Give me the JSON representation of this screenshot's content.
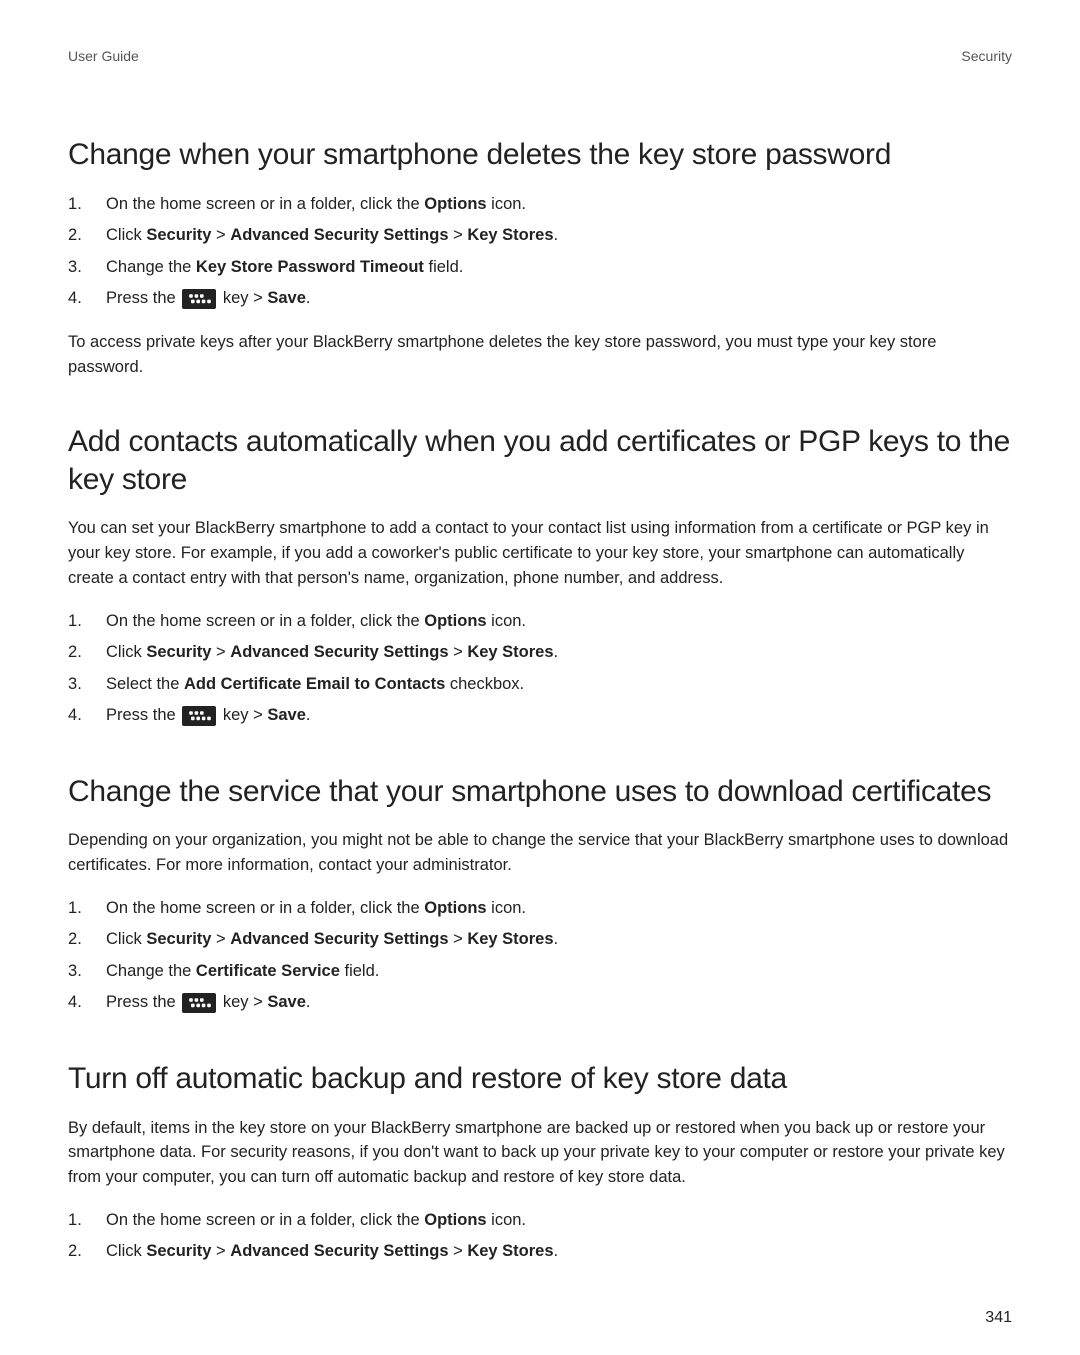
{
  "header": {
    "left": "User Guide",
    "right": "Security"
  },
  "sections": [
    {
      "title": "Change when your smartphone deletes the key store password",
      "intro": "",
      "steps": [
        [
          {
            "t": "On the home screen or in a folder, click the "
          },
          {
            "t": "Options",
            "b": true
          },
          {
            "t": " icon."
          }
        ],
        [
          {
            "t": "Click "
          },
          {
            "t": "Security",
            "b": true
          },
          {
            "t": " > "
          },
          {
            "t": "Advanced Security Settings",
            "b": true
          },
          {
            "t": " > "
          },
          {
            "t": "Key Stores",
            "b": true
          },
          {
            "t": "."
          }
        ],
        [
          {
            "t": "Change the "
          },
          {
            "t": "Key Store Password Timeout",
            "b": true
          },
          {
            "t": " field."
          }
        ],
        [
          {
            "t": "Press the "
          },
          {
            "icon": "bb-key"
          },
          {
            "t": " key > "
          },
          {
            "t": "Save",
            "b": true
          },
          {
            "t": "."
          }
        ]
      ],
      "after": "To access private keys after your BlackBerry smartphone deletes the key store password, you must type your key store password."
    },
    {
      "title": "Add contacts automatically when you add certificates or PGP keys to the key store",
      "intro": "You can set your BlackBerry smartphone to add a contact to your contact list using information from a certificate or PGP key in your key store. For example, if you add a coworker's public certificate to your key store, your smartphone can automatically create a contact entry with that person's name, organization, phone number, and address.",
      "steps": [
        [
          {
            "t": "On the home screen or in a folder, click the "
          },
          {
            "t": "Options",
            "b": true
          },
          {
            "t": " icon."
          }
        ],
        [
          {
            "t": "Click "
          },
          {
            "t": "Security",
            "b": true
          },
          {
            "t": " > "
          },
          {
            "t": "Advanced Security Settings",
            "b": true
          },
          {
            "t": " > "
          },
          {
            "t": "Key Stores",
            "b": true
          },
          {
            "t": "."
          }
        ],
        [
          {
            "t": "Select the "
          },
          {
            "t": "Add Certificate Email to Contacts",
            "b": true
          },
          {
            "t": " checkbox."
          }
        ],
        [
          {
            "t": "Press the "
          },
          {
            "icon": "bb-key"
          },
          {
            "t": " key > "
          },
          {
            "t": "Save",
            "b": true
          },
          {
            "t": "."
          }
        ]
      ],
      "after": ""
    },
    {
      "title": "Change the service that your smartphone uses to download certificates",
      "intro": "Depending on your organization, you might not be able to change the service that your BlackBerry smartphone uses to download certificates. For more information, contact your administrator.",
      "steps": [
        [
          {
            "t": "On the home screen or in a folder, click the "
          },
          {
            "t": "Options",
            "b": true
          },
          {
            "t": " icon."
          }
        ],
        [
          {
            "t": "Click "
          },
          {
            "t": "Security",
            "b": true
          },
          {
            "t": " > "
          },
          {
            "t": "Advanced Security Settings",
            "b": true
          },
          {
            "t": " > "
          },
          {
            "t": "Key Stores",
            "b": true
          },
          {
            "t": "."
          }
        ],
        [
          {
            "t": "Change the "
          },
          {
            "t": "Certificate Service",
            "b": true
          },
          {
            "t": " field."
          }
        ],
        [
          {
            "t": "Press the "
          },
          {
            "icon": "bb-key"
          },
          {
            "t": " key > "
          },
          {
            "t": "Save",
            "b": true
          },
          {
            "t": "."
          }
        ]
      ],
      "after": ""
    },
    {
      "title": "Turn off automatic backup and restore of key store data",
      "intro": "By default, items in the key store on your BlackBerry smartphone are backed up or restored when you back up or restore your smartphone data. For security reasons, if you don't want to back up your private key to your computer or restore your private key from your computer, you can turn off automatic backup and restore of key store data.",
      "steps": [
        [
          {
            "t": "On the home screen or in a folder, click the "
          },
          {
            "t": "Options",
            "b": true
          },
          {
            "t": " icon."
          }
        ],
        [
          {
            "t": "Click "
          },
          {
            "t": "Security",
            "b": true
          },
          {
            "t": " > "
          },
          {
            "t": "Advanced Security Settings",
            "b": true
          },
          {
            "t": " > "
          },
          {
            "t": "Key Stores",
            "b": true
          },
          {
            "t": "."
          }
        ]
      ],
      "after": ""
    }
  ],
  "page_number": "341"
}
